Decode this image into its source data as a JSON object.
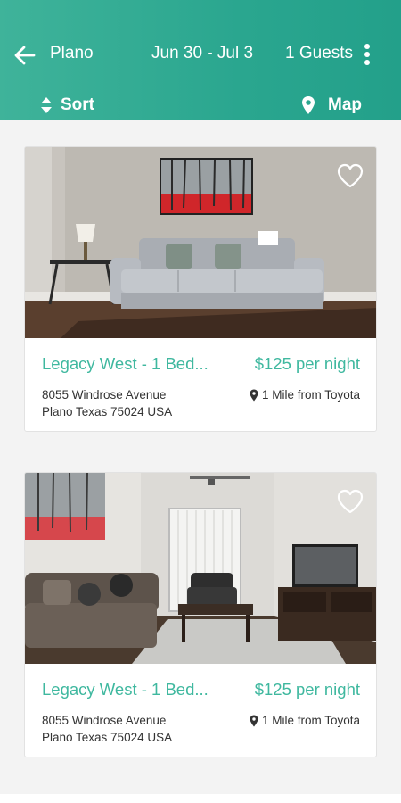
{
  "header": {
    "city": "Plano",
    "dates": "Jun 30 - Jul 3",
    "guests": "1 Guests",
    "sort_label": "Sort",
    "map_label": "Map"
  },
  "colors": {
    "header_start": "#3fb39a",
    "header_end": "#23a08a",
    "accent_text": "#3fb89f",
    "list_background": "#f3f3f3"
  },
  "listings": [
    {
      "title": "Legacy West - 1 Bed...",
      "price": "$125 per night",
      "address_line1": "8055 Windrose Avenue",
      "address_line2": "Plano Texas 75024 USA",
      "distance": "1 Mile from Toyota",
      "favorite": false
    },
    {
      "title": "Legacy West - 1 Bed...",
      "price": "$125 per night",
      "address_line1": "8055 Windrose Avenue",
      "address_line2": "Plano Texas 75024 USA",
      "distance": "1 Mile from Toyota",
      "favorite": false
    }
  ]
}
